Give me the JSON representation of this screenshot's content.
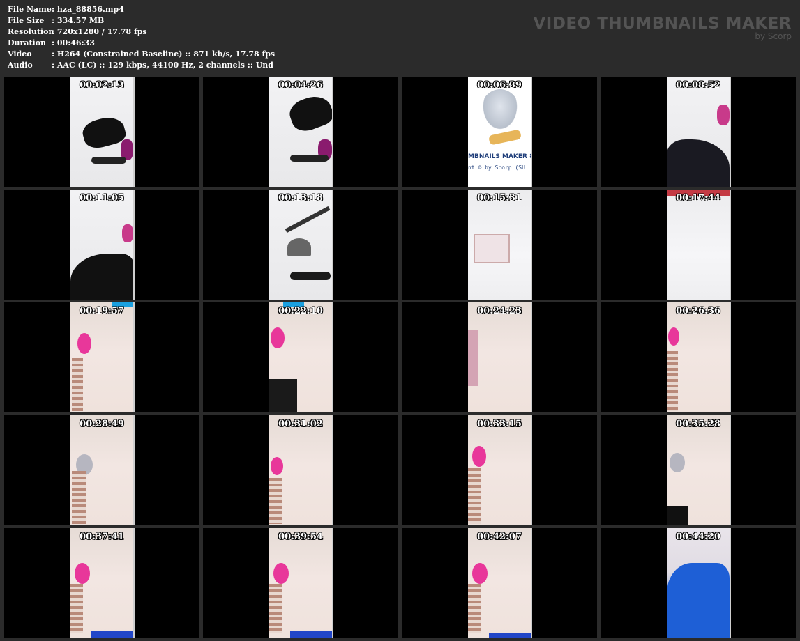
{
  "info": {
    "rows": [
      {
        "label": "File Name",
        "value": ":  hza_88856.mp4"
      },
      {
        "label": "File Size",
        "value": ":  334.57 MB"
      },
      {
        "label": "Resolution",
        "value": ":  720x1280 / 17.78 fps"
      },
      {
        "label": "Duration",
        "value": ":  00:46:33"
      },
      {
        "label": "Video",
        "value": ":  H264 (Constrained Baseline) :: 871 kb/s, 17.78 fps"
      },
      {
        "label": "Audio",
        "value": ":  AAC (LC) :: 129 kbps, 44100 Hz, 2 channels :: Und"
      }
    ]
  },
  "brand": {
    "title": "VIDEO THUMBNAILS MAKER",
    "subtitle": "by Scorp"
  },
  "thumbs": [
    {
      "time": "00:02:13"
    },
    {
      "time": "00:04:26"
    },
    {
      "time": "00:06:39"
    },
    {
      "time": "00:08:52"
    },
    {
      "time": "00:11:05"
    },
    {
      "time": "00:13:18"
    },
    {
      "time": "00:15:31"
    },
    {
      "time": "00:17:44"
    },
    {
      "time": "00:19:57"
    },
    {
      "time": "00:22:10"
    },
    {
      "time": "00:24:23"
    },
    {
      "time": "00:26:36"
    },
    {
      "time": "00:28:49"
    },
    {
      "time": "00:31:02"
    },
    {
      "time": "00:33:15"
    },
    {
      "time": "00:35:28"
    },
    {
      "time": "00:37:41"
    },
    {
      "time": "00:39:54"
    },
    {
      "time": "00:42:07"
    },
    {
      "time": "00:44:20"
    }
  ],
  "logo": {
    "text": "MBNAILS MAKER 8",
    "sub": "nt © by Scorp (SU"
  }
}
